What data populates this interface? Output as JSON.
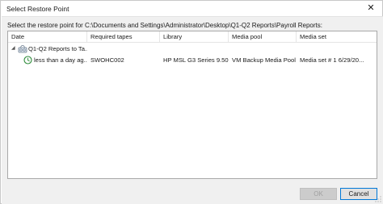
{
  "window": {
    "title": "Select Restore Point",
    "close_glyph": "✕"
  },
  "prompt": "Select the restore point for C:\\Documents and Settings\\Administrator\\Desktop\\Q1-Q2 Reports\\Payroll Reports:",
  "grid": {
    "columns": [
      "Date",
      "Required tapes",
      "Library",
      "Media pool",
      "Media set"
    ],
    "job_row": {
      "expander": "◢",
      "icon": "tape-job-icon",
      "name": "Q1-Q2 Reports to Ta..."
    },
    "point_row": {
      "icon": "clock-icon",
      "date": "less than a day ag...",
      "required_tapes": "SWOHC002",
      "library": "HP MSL G3 Series 9.50",
      "media_pool": "VM Backup Media Pool",
      "media_set": "Media set # 1 6/29/20..."
    }
  },
  "buttons": {
    "ok": "OK",
    "cancel": "Cancel"
  },
  "colors": {
    "accent": "#0078d7",
    "clock_green": "#2e8b3a"
  }
}
